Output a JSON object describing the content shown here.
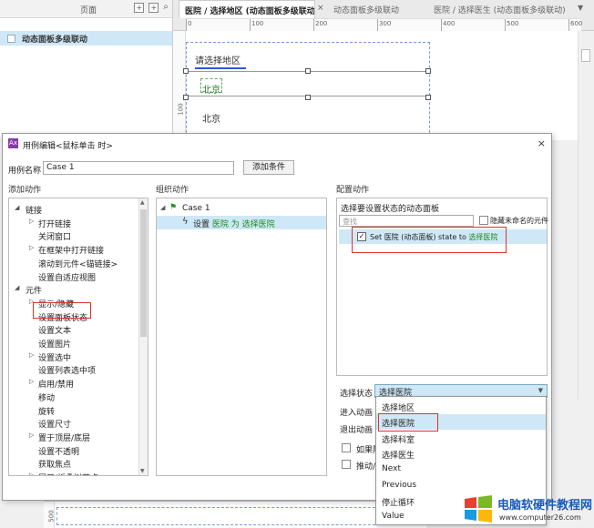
{
  "pages_panel": {
    "title": "页面",
    "page_item": "动态面板多级联动"
  },
  "tabs": [
    {
      "label": "医院 / 选择地区 (动态面板多级联动)",
      "active": true
    },
    {
      "label": "动态面板多级联动",
      "active": false
    },
    {
      "label": "医院 / 选择医生 (动态面板多级联动)",
      "active": false
    }
  ],
  "ruler": {
    "marks": [
      "0",
      "100",
      "200",
      "300",
      "400",
      "500",
      "600"
    ],
    "v_mark": "100",
    "lower_mark": "500"
  },
  "canvas": {
    "region_title": "请选择地区",
    "city_1": "北京",
    "city_2": "北京"
  },
  "dialog": {
    "title": "用例编辑<鼠标单击 时>",
    "close": "×",
    "case_name_label": "用例名称",
    "case_name_value": "Case 1",
    "add_condition": "添加条件",
    "sections": {
      "add_action": "添加动作",
      "organize_action": "组织动作",
      "configure_action": "配置动作"
    },
    "add_actions": [
      {
        "label": "链接",
        "indent": 0,
        "toggle": "◢"
      },
      {
        "label": "打开链接",
        "indent": 1,
        "toggle": "▷"
      },
      {
        "label": "关闭窗口",
        "indent": 1,
        "toggle": ""
      },
      {
        "label": "在框架中打开链接",
        "indent": 1,
        "toggle": "▷"
      },
      {
        "label": "滚动到元件<锚链接>",
        "indent": 1,
        "toggle": ""
      },
      {
        "label": "设置自适应视图",
        "indent": 1,
        "toggle": ""
      },
      {
        "label": "元件",
        "indent": 0,
        "toggle": "◢"
      },
      {
        "label": "显示/隐藏",
        "indent": 1,
        "toggle": "▷"
      },
      {
        "label": "设置面板状态",
        "indent": 1,
        "toggle": ""
      },
      {
        "label": "设置文本",
        "indent": 1,
        "toggle": ""
      },
      {
        "label": "设置图片",
        "indent": 1,
        "toggle": ""
      },
      {
        "label": "设置选中",
        "indent": 1,
        "toggle": "▷"
      },
      {
        "label": "设置列表选中项",
        "indent": 1,
        "toggle": ""
      },
      {
        "label": "启用/禁用",
        "indent": 1,
        "toggle": "▷"
      },
      {
        "label": "移动",
        "indent": 1,
        "toggle": ""
      },
      {
        "label": "旋转",
        "indent": 1,
        "toggle": ""
      },
      {
        "label": "设置尺寸",
        "indent": 1,
        "toggle": ""
      },
      {
        "label": "置于顶层/底层",
        "indent": 1,
        "toggle": "▷"
      },
      {
        "label": "设置不透明",
        "indent": 1,
        "toggle": ""
      },
      {
        "label": "获取焦点",
        "indent": 1,
        "toggle": ""
      },
      {
        "label": "展开/折叠树节点",
        "indent": 1,
        "toggle": "▷"
      }
    ],
    "organize": {
      "case_label": "Case 1",
      "action_prefix": "设置 ",
      "action_target": "医院",
      "action_mid": " 为 ",
      "action_state": "选择医院"
    },
    "configure": {
      "subtitle": "选择要设置状态的动态面板",
      "filter_placeholder": "查找",
      "hide_unnamed": "隐藏未命名的元件",
      "item_prefix": "Set ",
      "item_target": "医院",
      "item_mid": " (动态面板) state to ",
      "item_state": "选择医院",
      "item_checked": "✓",
      "state_label": "选择状态",
      "state_value": "选择医院",
      "enter_anim": "进入动画",
      "exit_anim": "退出动画",
      "option_1": "如果隐",
      "option_2": "推动/拉"
    },
    "state_options": [
      "选择地区",
      "选择医院",
      "选择科室",
      "选择医生",
      "Next",
      "Previous",
      "停止循环",
      "Value"
    ],
    "selected_option_index": 1
  },
  "watermark": {
    "title": "电脑软硬件教程网",
    "url": "www.computer26.com"
  }
}
